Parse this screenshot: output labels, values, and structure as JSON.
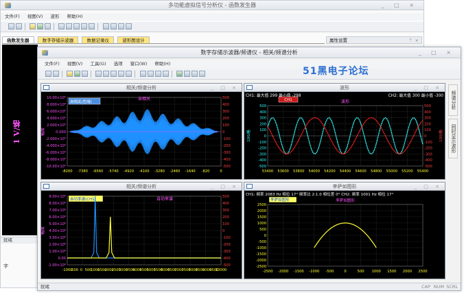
{
  "back_window": {
    "title": "多功能虚拟信号分析仪 - 函数发生器",
    "menus": [
      "文件(F)",
      "视图(V)",
      "波形",
      "帮助(H)"
    ],
    "tabs": [
      "函数发生器",
      "数字存储示波器",
      "数据记录仪",
      "波形图设计"
    ],
    "property_panel_title": "属性设置",
    "y_axis_label": "1 V/格",
    "status": "就绪",
    "side_char": "字"
  },
  "front_window": {
    "title": "数字存储示波器/频谱仪 - 相关/频谱分析",
    "menus": [
      "文件(F)",
      "视图(V)",
      "工具(G)",
      "选项",
      "窗口(W)",
      "帮助(H)"
    ],
    "watermark": "51黑电子论坛",
    "status": "就绪",
    "status_right": [
      "CAP",
      "NUM",
      "SCRL"
    ],
    "side_tabs": [
      "频谱分析",
      "同时显示波形"
    ]
  },
  "panels": {
    "p1": {
      "title": "相关/频谱分析",
      "plot_title": "自相关",
      "legend": "自相关(色域)",
      "left_axis_label": "幅度",
      "left_ticks": [
        "10.00×10⁵",
        "8.000×10⁵",
        "6.000×10⁵",
        "4.000×10⁵",
        "2.000×10⁵",
        "0.000",
        "-2.000×10⁵",
        "-4.000×10⁵",
        "-6.000×10⁵",
        "-8.000×10⁵",
        "-10.00×10⁵"
      ],
      "right_ticks": [
        "500",
        "400",
        "300",
        "200",
        "100",
        "0",
        "-100",
        "-200",
        "-300",
        "-400",
        "-500"
      ],
      "x_ticks": [
        "-8200",
        "-7380",
        "-6560",
        "-5740",
        "-4920",
        "-4100",
        "-3280",
        "-2460",
        "-1640",
        "-820",
        "0"
      ],
      "colors": {
        "trace": "#1e90ff",
        "axis_left": "#ff55ff",
        "axis_right": "#ff4040",
        "x": "#ffff33"
      }
    },
    "p2": {
      "title": "波形",
      "plot_title": "波形",
      "ch1_label": "CH1: 最大值 299 最小值 -298",
      "ch2_label": "CH2: 最大值 300 最小值 -300",
      "legend": "CH1",
      "left_axis_label": "100/格",
      "right_axis_label": "100/格",
      "y_ticks": [
        "500",
        "400",
        "300",
        "200",
        "100",
        "0",
        "-100",
        "-200",
        "-300",
        "-400",
        "-500"
      ],
      "x_ticks": [
        "53400",
        "53600",
        "53800",
        "54000",
        "54200",
        "54400",
        "54600",
        "54800",
        "55000",
        "55200",
        "55400"
      ],
      "colors": {
        "ch1": "#33ffff",
        "ch2": "#ff2020",
        "axis_left": "#33ffff",
        "axis_right": "#ff4040",
        "x": "#ffff33"
      }
    },
    "p3": {
      "title": "相关/频谱分析",
      "plot_title": "自功率谱",
      "legend": "自功率谱(CH1)",
      "left_axis_label": "幅度",
      "left_ticks": [
        "9.00×10⁶",
        "8.00×10⁶",
        "7.00×10⁶",
        "6.00×10⁶",
        "5.00×10⁶",
        "4.00×10⁶",
        "3.00×10⁶",
        "2.00×10⁶",
        "1.00×10⁶",
        "0.00",
        "-1.00×10⁶"
      ],
      "right_ticks": [
        "500",
        "400",
        "300",
        "200",
        "100",
        "0",
        "-100",
        "-200",
        "-300",
        "-400",
        "-500"
      ],
      "x_ticks": [
        "-1000",
        "-500",
        "0",
        "500",
        "1000",
        "1500",
        "2000",
        "2500",
        "3000",
        "3500",
        "4000",
        "4500",
        "5000",
        "5500",
        "6000",
        "6500",
        "7000",
        "7500",
        "8000",
        "8500",
        "9000",
        "9500",
        "10000"
      ],
      "colors": {
        "ch1": "#1e90ff",
        "ch2": "#ffff33",
        "axis_left": "#ff55ff",
        "axis_right": "#ff4040",
        "x": "#ffff33"
      }
    },
    "p4": {
      "title": "李萨如图形",
      "info": "CH1: 频率 2083 Hz 相位 17° 频率比 2:1.0 相位差 0° CH2: 频率 1001 Hz 相位 17°",
      "legend": "李萨如图形",
      "plot_title": "李萨如图形",
      "y_ticks": [
        "2500",
        "2000",
        "1500",
        "1000",
        "500",
        "0",
        "-500",
        "-1000",
        "-1500",
        "-2000",
        "-2500"
      ],
      "x_ticks": [
        "-2500",
        "-2000",
        "-1500",
        "-1000",
        "-500",
        "0",
        "500",
        "1000",
        "1500",
        "2000",
        "2500"
      ],
      "colors": {
        "trace": "#ffff33",
        "axis": "#ffff33"
      }
    }
  },
  "chart_data": [
    {
      "type": "line",
      "title": "自相关",
      "description_series": [
        {
          "name": "自相关(色域)",
          "envelope": "diamond",
          "peak": 1.0
        }
      ],
      "xlim": [
        -8200,
        0
      ],
      "ylim": [
        -1000000,
        1000000
      ],
      "x_ticks": [
        -8200,
        -7380,
        -6560,
        -5740,
        -4920,
        -4100,
        -3280,
        -2460,
        -1640,
        -820,
        0
      ]
    },
    {
      "type": "line",
      "title": "波形",
      "series": [
        {
          "name": "CH1",
          "max": 299,
          "min": -298,
          "cycles": 5.5
        },
        {
          "name": "CH2",
          "max": 300,
          "min": -300,
          "cycles": 2.75
        }
      ],
      "xlim": [
        53400,
        55400
      ],
      "ylim": [
        -500,
        500
      ]
    },
    {
      "type": "line",
      "title": "自功率谱",
      "series": [
        {
          "name": "CH1",
          "peak_x": 1001,
          "peak_y": 9000000
        },
        {
          "name": "CH2",
          "peak_x": 2083,
          "peak_y": 6000000
        }
      ],
      "xlim": [
        -1000,
        10000
      ],
      "ylim": [
        -1000000,
        9000000
      ]
    },
    {
      "type": "scatter",
      "title": "李萨如图形",
      "ratio": "2:1",
      "xlim": [
        -2500,
        2500
      ],
      "ylim": [
        -2500,
        2500
      ],
      "amplitude": [
        1000,
        1000
      ]
    }
  ]
}
